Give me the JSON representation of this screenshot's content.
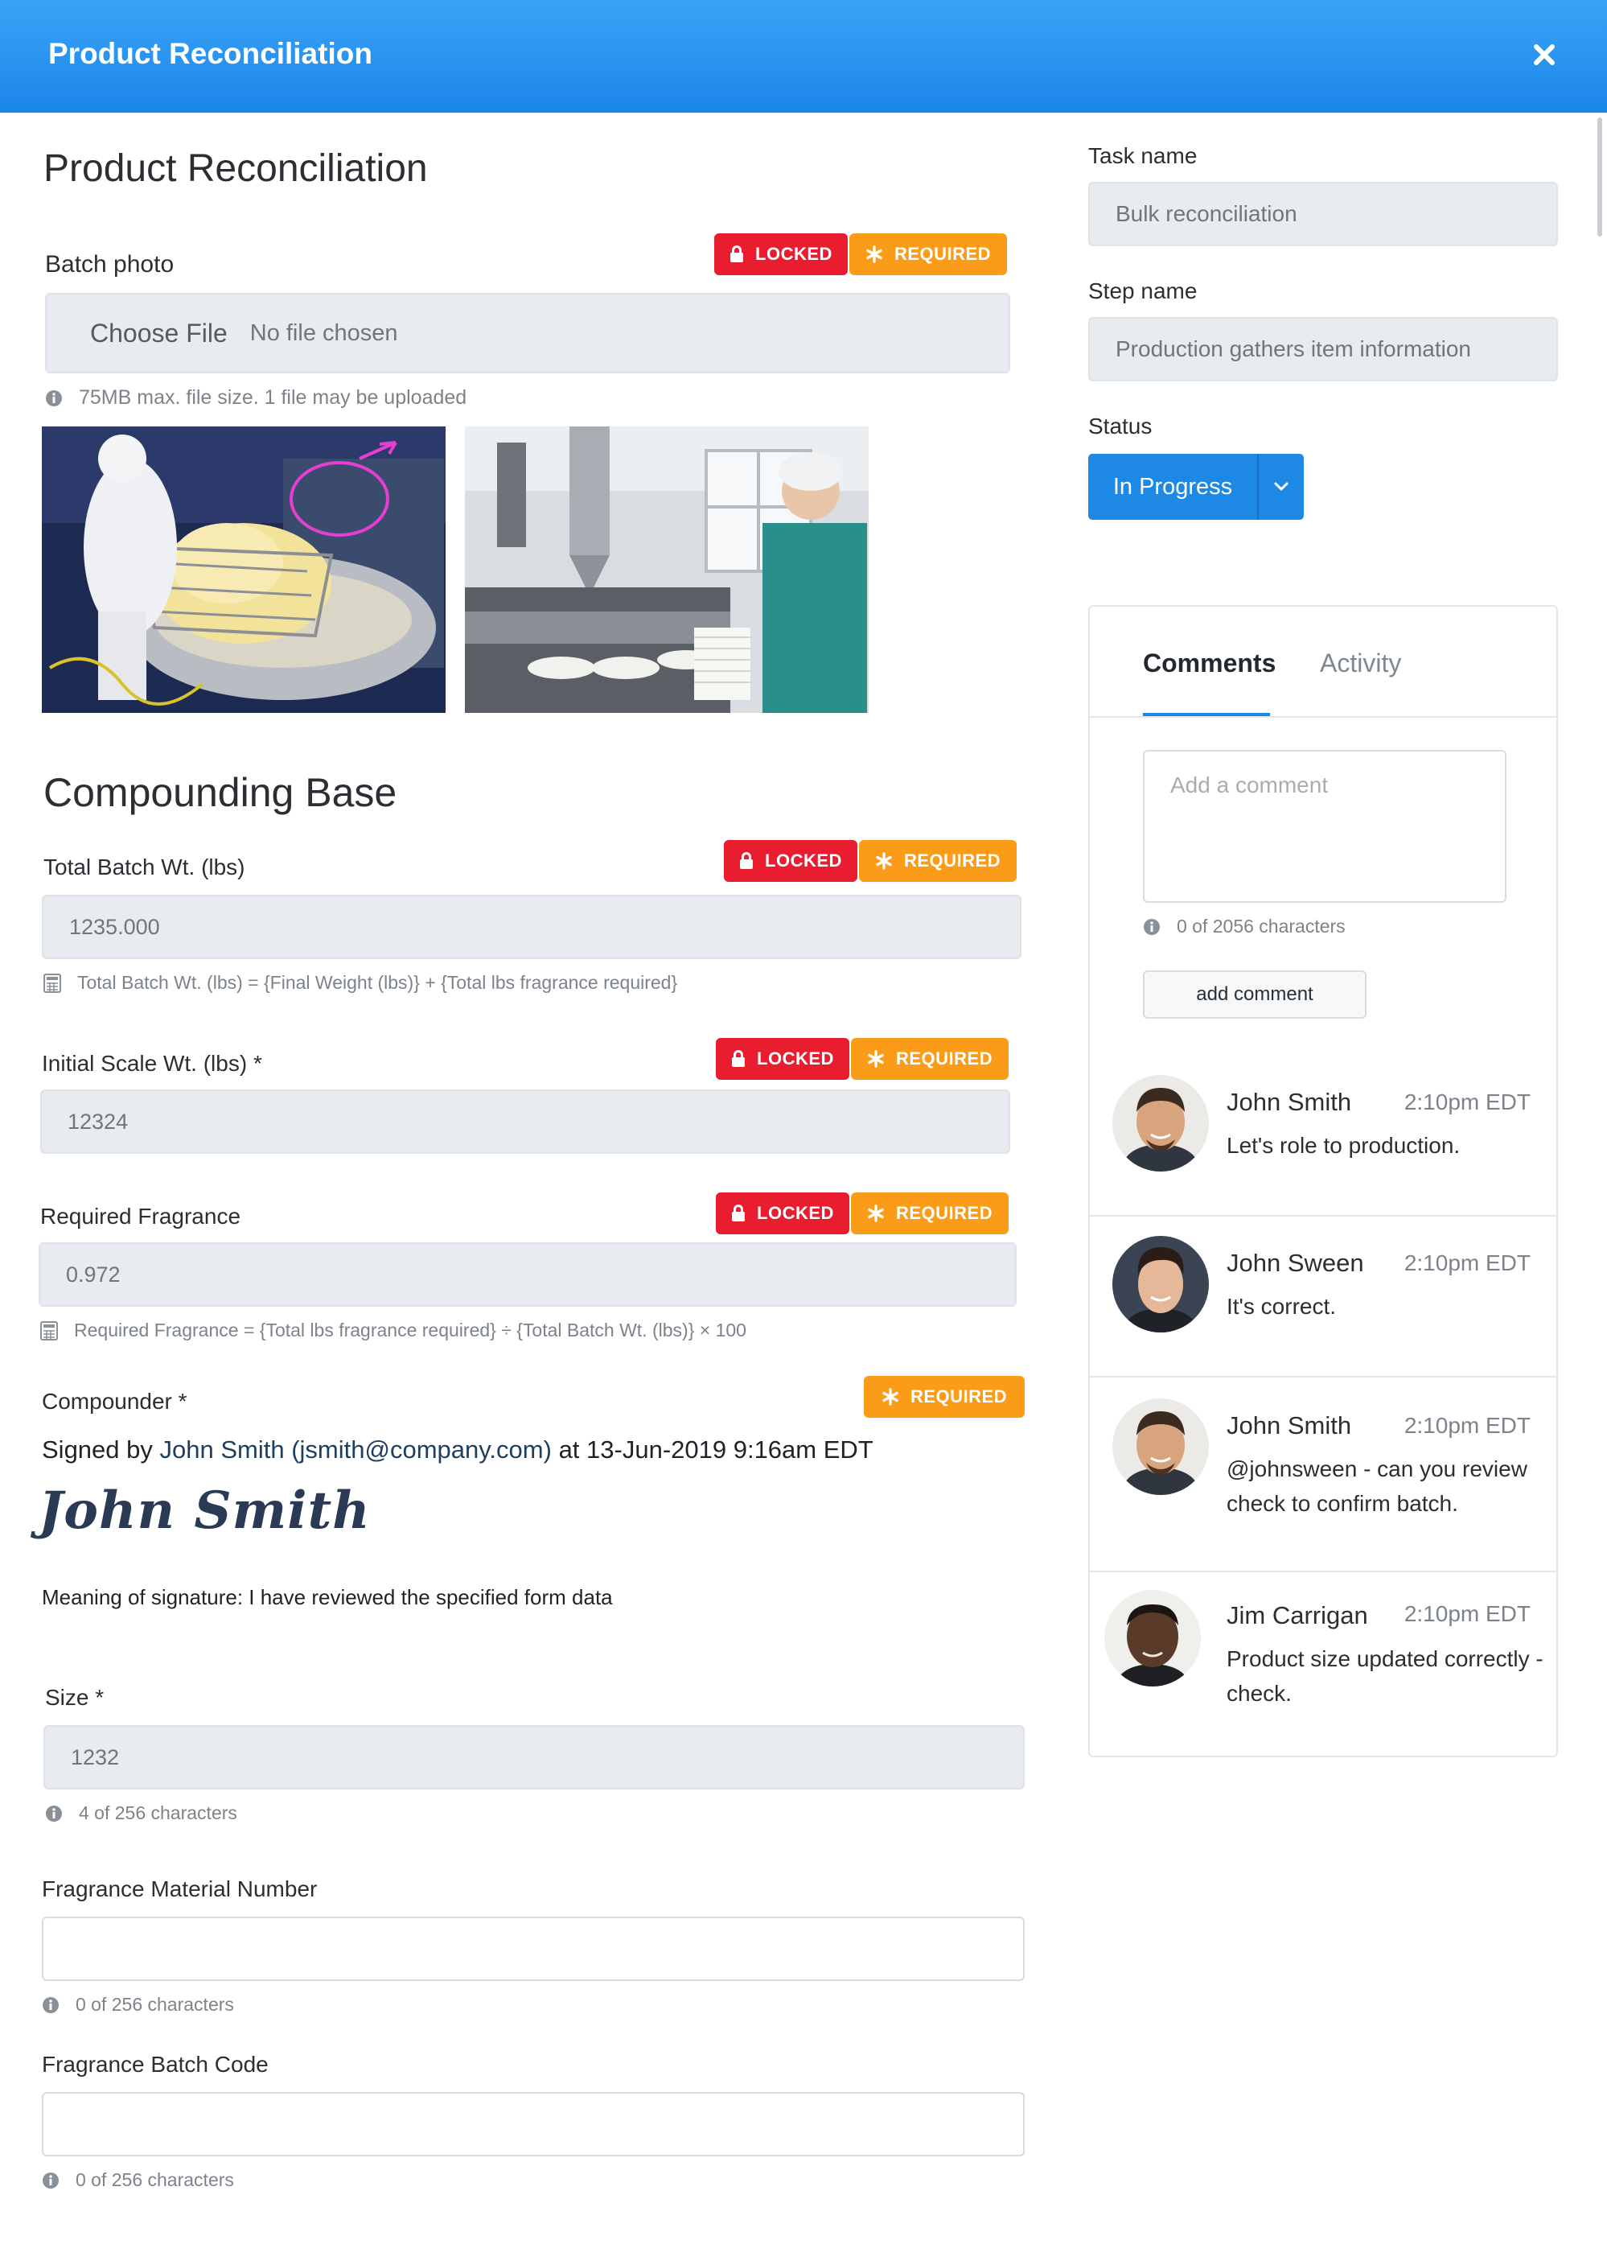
{
  "header": {
    "title": "Product Reconciliation"
  },
  "form": {
    "title": "Product Reconciliation",
    "batch_photo": {
      "label": "Batch photo",
      "choose_file": "Choose File",
      "file_status": "No file chosen",
      "hint": "75MB max. file size. 1 file may be uploaded"
    },
    "badges": {
      "locked": "LOCKED",
      "required": "REQUIRED"
    },
    "section_title": "Compounding Base",
    "total_batch": {
      "label": "Total Batch Wt. (lbs)",
      "value": "1235.000",
      "formula": "Total Batch Wt. (lbs) = {Final Weight (lbs)} + {Total lbs fragrance required}"
    },
    "initial_scale": {
      "label": "Initial Scale Wt. (lbs) *",
      "value": "12324"
    },
    "required_fragrance": {
      "label": "Required Fragrance",
      "value": "0.972",
      "formula": "Required Fragrance = {Total lbs fragrance required} ÷ {Total Batch Wt. (lbs)} × 100"
    },
    "compounder": {
      "label": "Compounder *",
      "signed_prefix": "Signed by",
      "signer": "John Smith (jsmith@company.com)",
      "signed_suffix": "at 13-Jun-2019 9:16am EDT",
      "signature": "John Smith",
      "meaning": "Meaning of signature: I have reviewed the specified form data"
    },
    "size": {
      "label": "Size *",
      "value": "1232",
      "hint": "4 of 256 characters"
    },
    "fragrance_material": {
      "label": "Fragrance Material Number",
      "value": "",
      "hint": "0 of 256 characters"
    },
    "fragrance_batch": {
      "label": "Fragrance Batch Code",
      "value": "",
      "hint": "0 of 256 characters"
    }
  },
  "sidebar": {
    "task_name": {
      "label": "Task name",
      "value": "Bulk reconciliation"
    },
    "step_name": {
      "label": "Step name",
      "value": "Production gathers item information"
    },
    "status": {
      "label": "Status",
      "value": "In Progress"
    },
    "tabs": {
      "comments": "Comments",
      "activity": "Activity"
    },
    "comment_placeholder": "Add a comment",
    "comment_counter": "0 of 2056 characters",
    "add_comment": "add comment",
    "comments": [
      {
        "author": "John Smith",
        "time": "2:10pm EDT",
        "text": "Let's role to production."
      },
      {
        "author": "John Sween",
        "time": "2:10pm EDT",
        "text": "It's correct."
      },
      {
        "author": "John Smith",
        "time": "2:10pm EDT",
        "text": "@johnsween - can you review check to confirm batch."
      },
      {
        "author": "Jim Carrigan",
        "time": "2:10pm EDT",
        "text": "Product size updated correctly - check."
      }
    ]
  },
  "colors": {
    "header": "#1b86ea",
    "locked": "#ea1c2f",
    "required": "#fb9c18",
    "primary": "#1e88e5"
  },
  "icons": [
    "close-icon",
    "lock-icon",
    "asterisk-icon",
    "info-icon",
    "calculator-icon",
    "chevron-down-icon"
  ]
}
